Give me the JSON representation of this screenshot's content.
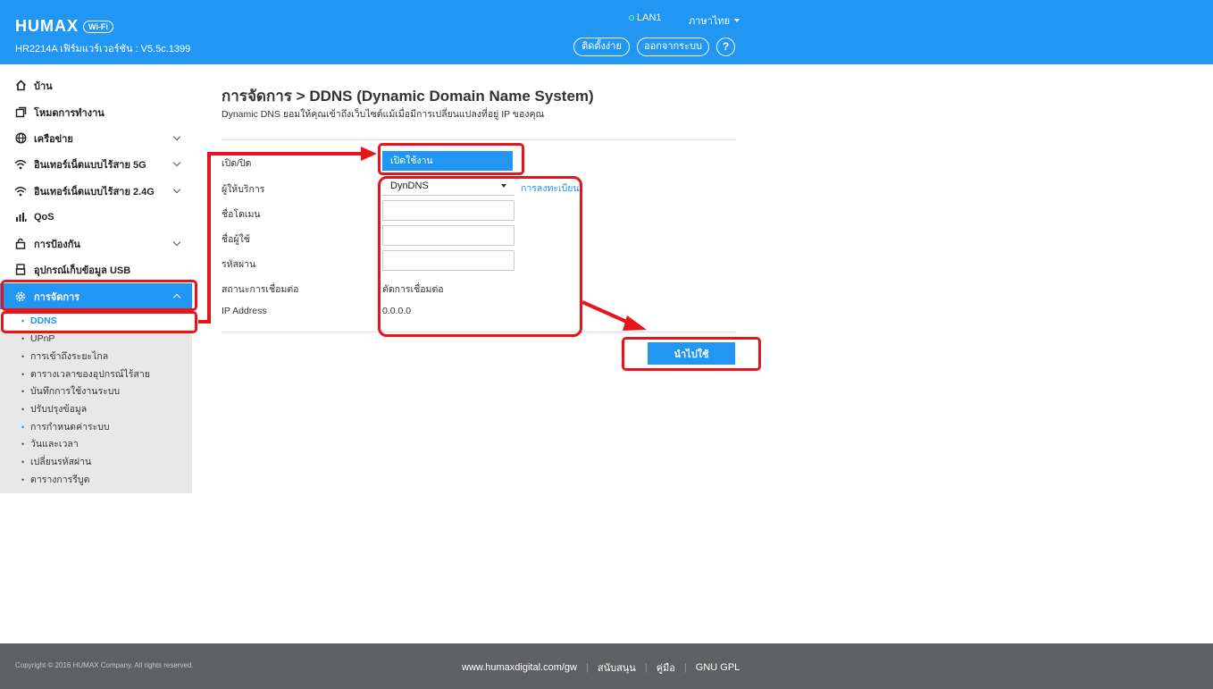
{
  "header": {
    "logo": "HUMAX",
    "wifi_badge": "Wi-Fi",
    "firmware": "HR2214A เฟิร์มแวร์เวอร์ชัน : V5.5c.1399",
    "lan_status": "LAN1",
    "language": "ภาษาไทย",
    "setup_button": "ติดตั้งง่าย",
    "logout_button": "ออกจากระบบ",
    "help": "?"
  },
  "sidebar": {
    "items": [
      {
        "label": "บ้าน",
        "icon": "home-icon"
      },
      {
        "label": "โหมดการทำงาน",
        "icon": "copy-icon"
      },
      {
        "label": "เครือข่าย",
        "icon": "globe-icon"
      },
      {
        "label": "อินเทอร์เน็ตแบบไร้สาย 5G",
        "icon": "wifi-icon"
      },
      {
        "label": "อินเทอร์เน็ตแบบไร้สาย 2.4G",
        "icon": "wifi-icon"
      },
      {
        "label": "QoS",
        "icon": "bar-chart-icon"
      },
      {
        "label": "การป้องกัน",
        "icon": "lock-icon"
      },
      {
        "label": "อุปกรณ์เก็บข้อมูล USB",
        "icon": "usb-icon"
      },
      {
        "label": "การจัดการ",
        "icon": "gear-icon"
      }
    ],
    "subitems": [
      "DDNS",
      "UPnP",
      "การเข้าถึงระยะไกล",
      "ตารางเวลาของอุปกรณ์ไร้สาย",
      "บันทึกการใช้งานระบบ",
      "ปรับปรุงข้อมูล",
      "การกำหนดค่าระบบ",
      "วันและเวลา",
      "เปลี่ยนรหัสผ่าน",
      "ตารางการรีบูต"
    ]
  },
  "main": {
    "title": "การจัดการ > DDNS (Dynamic Domain Name System)",
    "description": "Dynamic DNS ยอมให้คุณเข้าถึงเว็บไซต์แม้เมื่อมีการเปลี่ยนแปลงที่อยู่ IP ของคุณ",
    "labels": {
      "enable": "เปิด/ปิด",
      "provider": "ผู้ให้บริการ",
      "domain": "ชื่อโดเมน",
      "username": "ชื่อผู้ใช้",
      "password": "รหัสผ่าน",
      "status": "สถานะการเชื่อมต่อ",
      "ip": "IP Address"
    },
    "enable_value": "เปิดใช้งาน",
    "provider_value": "DynDNS",
    "register_link": "การลงทะเบียน",
    "domain_value": "",
    "username_value": "",
    "password_value": "",
    "status_value": "ตัดการเชื่อมต่อ",
    "ip_value": "0.0.0.0",
    "apply_button": "นำไปใช้"
  },
  "footer": {
    "copyright": "Copyright © 2016 HUMAX Company. All rights reserved.",
    "website": "www.humaxdigital.com/gw",
    "support": "สนับสนุน",
    "manual": "คู่มือ",
    "gpl": "GNU GPL",
    "separator": "|"
  },
  "annotation_color": "#e8141c",
  "accent_color": "#2196f3"
}
